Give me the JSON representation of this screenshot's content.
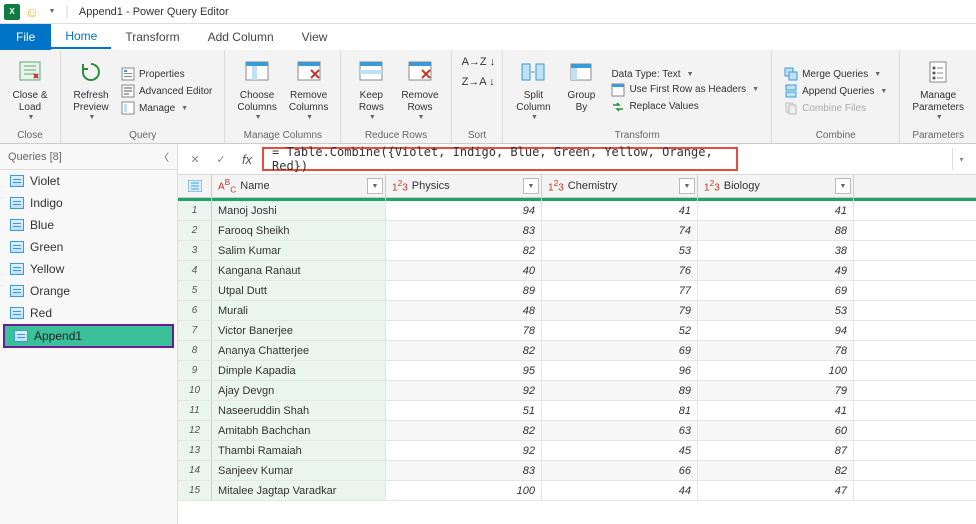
{
  "title": "Append1 - Power Query Editor",
  "tabs": {
    "file": "File",
    "home": "Home",
    "transform": "Transform",
    "addcolumn": "Add Column",
    "view": "View"
  },
  "ribbon": {
    "close": {
      "close_load": "Close &\nLoad",
      "group": "Close"
    },
    "query": {
      "refresh": "Refresh\nPreview",
      "properties": "Properties",
      "adv_editor": "Advanced Editor",
      "manage": "Manage",
      "group": "Query"
    },
    "cols": {
      "choose": "Choose\nColumns",
      "remove": "Remove\nColumns",
      "group": "Manage Columns"
    },
    "rows": {
      "keep": "Keep\nRows",
      "remove": "Remove\nRows",
      "group": "Reduce Rows"
    },
    "sort": {
      "group": "Sort"
    },
    "transform": {
      "split": "Split\nColumn",
      "groupby": "Group\nBy",
      "datatype": "Data Type: Text",
      "firstrow": "Use First Row as Headers",
      "replace": "Replace Values",
      "group": "Transform"
    },
    "combine": {
      "merge": "Merge Queries",
      "append": "Append Queries",
      "combinefiles": "Combine Files",
      "group": "Combine"
    },
    "params": {
      "manage": "Manage\nParameters",
      "group": "Parameters"
    }
  },
  "queries_header": "Queries [8]",
  "queries": [
    "Violet",
    "Indigo",
    "Blue",
    "Green",
    "Yellow",
    "Orange",
    "Red",
    "Append1"
  ],
  "formula": "= Table.Combine({Violet, Indigo, Blue, Green, Yellow, Orange, Red})",
  "columns": {
    "name": "Name",
    "physics": "Physics",
    "chemistry": "Chemistry",
    "biology": "Biology"
  },
  "rows_data": [
    {
      "n": 1,
      "name": "Manoj Joshi",
      "p": 94,
      "c": 41,
      "b": 41
    },
    {
      "n": 2,
      "name": "Farooq Sheikh",
      "p": 83,
      "c": 74,
      "b": 88
    },
    {
      "n": 3,
      "name": "Salim Kumar",
      "p": 82,
      "c": 53,
      "b": 38
    },
    {
      "n": 4,
      "name": "Kangana Ranaut",
      "p": 40,
      "c": 76,
      "b": 49
    },
    {
      "n": 5,
      "name": "Utpal Dutt",
      "p": 89,
      "c": 77,
      "b": 69
    },
    {
      "n": 6,
      "name": "Murali",
      "p": 48,
      "c": 79,
      "b": 53
    },
    {
      "n": 7,
      "name": "Victor Banerjee",
      "p": 78,
      "c": 52,
      "b": 94
    },
    {
      "n": 8,
      "name": "Ananya Chatterjee",
      "p": 82,
      "c": 69,
      "b": 78
    },
    {
      "n": 9,
      "name": "Dimple Kapadia",
      "p": 95,
      "c": 96,
      "b": 100
    },
    {
      "n": 10,
      "name": "Ajay Devgn",
      "p": 92,
      "c": 89,
      "b": 79
    },
    {
      "n": 11,
      "name": "Naseeruddin Shah",
      "p": 51,
      "c": 81,
      "b": 41
    },
    {
      "n": 12,
      "name": "Amitabh Bachchan",
      "p": 82,
      "c": 63,
      "b": 60
    },
    {
      "n": 13,
      "name": "Thambi Ramaiah",
      "p": 92,
      "c": 45,
      "b": 87
    },
    {
      "n": 14,
      "name": "Sanjeev Kumar",
      "p": 83,
      "c": 66,
      "b": 82
    },
    {
      "n": 15,
      "name": "Mitalee Jagtap Varadkar",
      "p": 100,
      "c": 44,
      "b": 47
    }
  ]
}
